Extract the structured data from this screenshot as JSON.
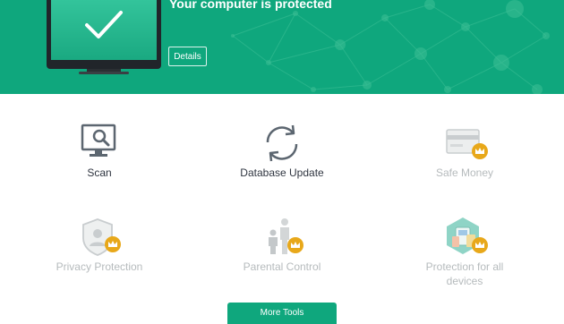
{
  "header": {
    "status_title": "Your computer is protected",
    "details_label": "Details"
  },
  "tiles": [
    {
      "label": "Scan",
      "icon": "scan-monitor-icon",
      "enabled": true
    },
    {
      "label": "Database Update",
      "icon": "refresh-icon",
      "enabled": true
    },
    {
      "label": "Safe Money",
      "icon": "credit-card-icon",
      "enabled": false,
      "premium": true
    },
    {
      "label": "Privacy Protection",
      "icon": "shield-user-icon",
      "enabled": false,
      "premium": true
    },
    {
      "label": "Parental Control",
      "icon": "family-icon",
      "enabled": false,
      "premium": true
    },
    {
      "label": "Protection for all",
      "label_line2": "devices",
      "icon": "devices-icon",
      "enabled": false,
      "premium": true
    }
  ],
  "footer": {
    "more_tools_label": "More Tools"
  },
  "colors": {
    "accent": "#0fa77d",
    "premium_crown": "#e8a81a",
    "disabled_text": "#b6bbbd",
    "active_text": "#2f3540",
    "active_icon": "#5c6670"
  }
}
